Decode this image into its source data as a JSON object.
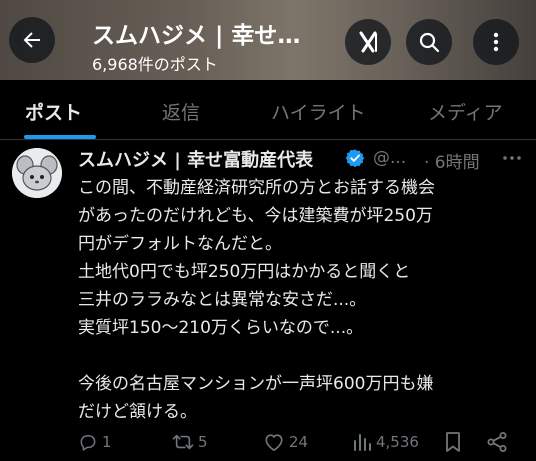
{
  "header": {
    "title": "スムハジメ | 幸せ…",
    "post_count": "6,968件のポスト"
  },
  "tabs": [
    {
      "label": "ポスト",
      "active": true
    },
    {
      "label": "返信",
      "active": false
    },
    {
      "label": "ハイライト",
      "active": false
    },
    {
      "label": "メディア",
      "active": false
    }
  ],
  "post": {
    "author_name": "スムハジメ | 幸せ富動産代表",
    "handle": "@...",
    "time": "· 6時間",
    "lines": [
      "この間、不動産経済研究所の方とお話する機会",
      "があったのだけれども、今は建築費が坪250万",
      "円がデフォルトなんだと。",
      "土地代0円でも坪250万円はかかると聞くと",
      "三井のララみなとは異常な安さだ...。",
      "実質坪150〜210万くらいなので...。",
      "",
      "今後の名古屋マンションが一声坪600万円も嫌",
      "だけど頷ける。"
    ],
    "actions": {
      "replies": "1",
      "reposts": "5",
      "likes": "24",
      "views": "4,536"
    }
  },
  "colors": {
    "accent": "#1d9bf0",
    "muted": "#71767b",
    "text": "#e7e9ea",
    "background": "#000000"
  },
  "icons": [
    "back-arrow-icon",
    "grok-icon",
    "search-icon",
    "more-vertical-icon",
    "verified-badge-icon",
    "more-horizontal-icon",
    "reply-icon",
    "repost-icon",
    "like-icon",
    "views-icon",
    "bookmark-icon",
    "share-icon"
  ]
}
